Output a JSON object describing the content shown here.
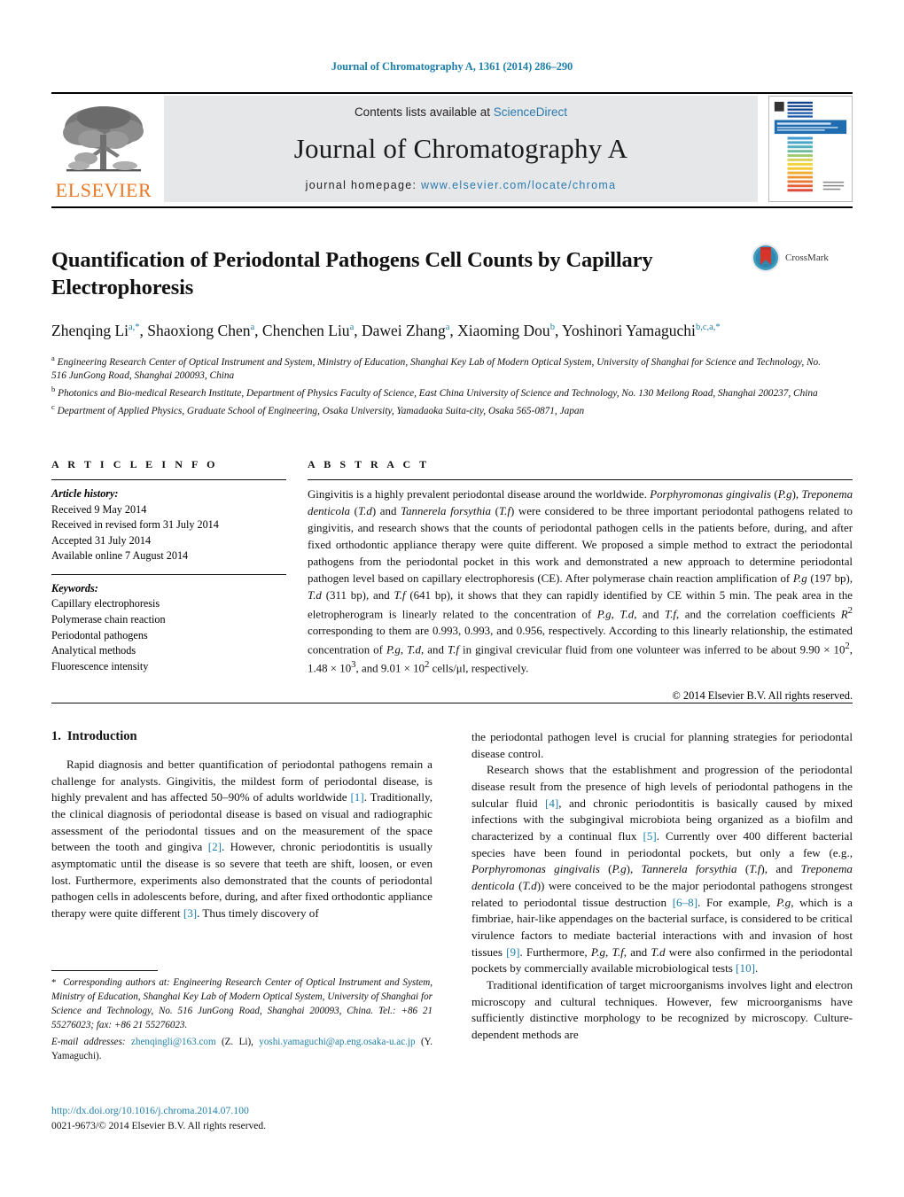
{
  "running_head": "Journal of Chromatography A, 1361 (2014) 286–290",
  "masthead": {
    "publisher_logo_text": "ELSEVIER",
    "contents_prefix": "Contents lists available at ",
    "contents_link": "ScienceDirect",
    "journal_name": "Journal of Chromatography A",
    "homepage_prefix": "journal homepage: ",
    "homepage_url": "www.elsevier.com/locate/chroma",
    "cover_title": "JOURNAL OF CHROMATOGRAPHY A",
    "colors": {
      "elsevier_orange": "#E87722",
      "link_blue": "#2a7ab0",
      "sd_box_gray": "#e6e7e8",
      "cover_band_blue": "#1f6cb0"
    }
  },
  "article": {
    "title": "Quantification of Periodontal Pathogens Cell Counts by Capillary Electrophoresis",
    "crossmark_label": "CrossMark",
    "authors_line1": "Zhenqing Li",
    "authors_html": "Zhenqing Li<sup>a,*</sup>, Shaoxiong Chen<sup>a</sup>, Chenchen Liu<sup>a</sup>, Dawei Zhang<sup>a</sup>, Xiaoming Dou<sup>b</sup>, Yoshinori Yamaguchi<sup>b,c,a,*</sup>",
    "authors": [
      {
        "name": "Zhenqing Li",
        "marks": "a,*"
      },
      {
        "name": "Shaoxiong Chen",
        "marks": "a"
      },
      {
        "name": "Chenchen Liu",
        "marks": "a"
      },
      {
        "name": "Dawei Zhang",
        "marks": "a"
      },
      {
        "name": "Xiaoming Dou",
        "marks": "b"
      },
      {
        "name": "Yoshinori Yamaguchi",
        "marks": "b,c,a,*"
      }
    ],
    "affiliations": [
      {
        "mark": "a",
        "text": "Engineering Research Center of Optical Instrument and System, Ministry of Education, Shanghai Key Lab of Modern Optical System, University of Shanghai for Science and Technology, No. 516 JunGong Road, Shanghai 200093, China"
      },
      {
        "mark": "b",
        "text": "Photonics and Bio-medical Research Institute, Department of Physics Faculty of Science, East China University of Science and Technology, No. 130 Meilong Road, Shanghai 200237, China"
      },
      {
        "mark": "c",
        "text": "Department of Applied Physics, Graduate School of Engineering, Osaka University, Yamadaoka Suita-city, Osaka 565-0871, Japan"
      }
    ]
  },
  "article_info": {
    "heading": "A R T I C L E   I N F O",
    "history_label": "Article history:",
    "history": [
      "Received 9 May 2014",
      "Received in revised form 31 July 2014",
      "Accepted 31 July 2014",
      "Available online 7 August 2014"
    ],
    "keywords_label": "Keywords:",
    "keywords": [
      "Capillary electrophoresis",
      "Polymerase chain reaction",
      "Periodontal pathogens",
      "Analytical methods",
      "Fluorescence intensity"
    ]
  },
  "abstract": {
    "heading": "A B S T R A C T",
    "paragraph_html": "Gingivitis is a highly prevalent periodontal disease around the worldwide. <i>Porphyromonas gingivalis</i> (<i>P.g</i>), <i>Treponema denticola</i> (<i>T.d</i>) and <i>Tannerela forsythia</i> (<i>T.f</i>) were considered to be three important periodontal pathogens related to gingivitis, and research shows that the counts of periodontal pathogen cells in the patients before, during, and after fixed orthodontic appliance therapy were quite different. We proposed a simple method to extract the periodontal pathogens from the periodontal pocket in this work and demonstrated a new approach to determine periodontal pathogen level based on capillary electrophoresis (CE). After polymerase chain reaction amplification of <i>P.g</i> (197 bp), <i>T.d</i> (311 bp), and <i>T.f</i> (641 bp), it shows that they can rapidly identified by CE within 5 min. The peak area in the eletropherogram is linearly related to the concentration of <i>P.g</i>, <i>T.d</i>, and <i>T.f</i>, and the correlation coefficients <i>R</i><sup>2</sup> corresponding to them are 0.993, 0.993, and 0.956, respectively. According to this linearly relationship, the estimated concentration of <i>P.g</i>, <i>T.d</i>, and <i>T.f</i> in gingival crevicular fluid from one volunteer was inferred to be about 9.90 × 10<sup>2</sup>, 1.48 × 10<sup>3</sup>, and 9.01 × 10<sup>2</sup> cells/μl, respectively.",
    "copyright": "© 2014 Elsevier B.V. All rights reserved."
  },
  "introduction": {
    "number": "1.",
    "heading": "Introduction",
    "left_p1_html": "Rapid diagnosis and better quantification of periodontal pathogens remain a challenge for analysts. Gingivitis, the mildest form of periodontal disease, is highly prevalent and has affected 50–90% of adults worldwide <span class=\"ref\">[1]</span>. Traditionally, the clinical diagnosis of periodontal disease is based on visual and radiographic assessment of the periodontal tissues and on the measurement of the space between the tooth and gingiva <span class=\"ref\">[2]</span>. However, chronic periodontitis is usually asymptomatic until the disease is so severe that teeth are shift, loosen, or even lost. Furthermore, experiments also demonstrated that the counts of periodontal pathogen cells in adolescents before, during, and after fixed orthodontic appliance therapy were quite different <span class=\"ref\">[3]</span>. Thus timely discovery of",
    "right_p1_html": "the periodontal pathogen level is crucial for planning strategies for periodontal disease control.",
    "right_p2_html": "Research shows that the establishment and progression of the periodontal disease result from the presence of high levels of periodontal pathogens in the sulcular fluid <span class=\"ref\">[4]</span>, and chronic periodontitis is basically caused by mixed infections with the subgingival microbiota being organized as a biofilm and characterized by a continual flux <span class=\"ref\">[5]</span>. Currently over 400 different bacterial species have been found in periodontal pockets, but only a few (e.g., <i>Porphyromonas gingivalis</i> (<i>P.g</i>), <i>Tannerela forsythia</i> (<i>T.f</i>), and <i>Treponema denticola</i> (<i>T.d</i>)) were conceived to be the major periodontal pathogens strongest related to periodontal tissue destruction <span class=\"ref\">[6–8]</span>. For example, <i>P.g</i>, which is a fimbriae, hair-like appendages on the bacterial surface, is considered to be critical virulence factors to mediate bacterial interactions with and invasion of host tissues <span class=\"ref\">[9]</span>. Furthermore, <i>P.g</i>, <i>T.f</i>, and <i>T.d</i> were also confirmed in the periodontal pockets by commercially available microbiological tests <span class=\"ref\">[10]</span>.",
    "right_p3_html": "Traditional identification of target microorganisms involves light and electron microscopy and cultural techniques. However, few microorganisms have sufficiently distinctive morphology to be recognized by microscopy. Culture-dependent methods are"
  },
  "footnote": {
    "corresponding_html": "<span class=\"star\">*</span>&nbsp; <span class=\"fn-em\">Corresponding authors at: Engineering Research Center of Optical Instrument and System, Ministry of Education, Shanghai Key Lab of Modern Optical System, University of Shanghai for Science and Technology, No. 516 JunGong Road, Shanghai 200093, China. Tel.: +86 21 55276023; fax: +86 21 55276023.</span>",
    "email_label": "E-mail addresses:",
    "email_html": "<span class=\"fn-em\">E-mail addresses:</span> <span class=\"link\">zhenqingli@163.com</span> (Z. Li), <span class=\"link\">yoshi.yamaguchi@ap.eng.osaka-u.ac.jp</span> (Y. Yamaguchi).",
    "doi": "http://dx.doi.org/10.1016/j.chroma.2014.07.100",
    "issn": "0021-9673/© 2014 Elsevier B.V. All rights reserved."
  }
}
